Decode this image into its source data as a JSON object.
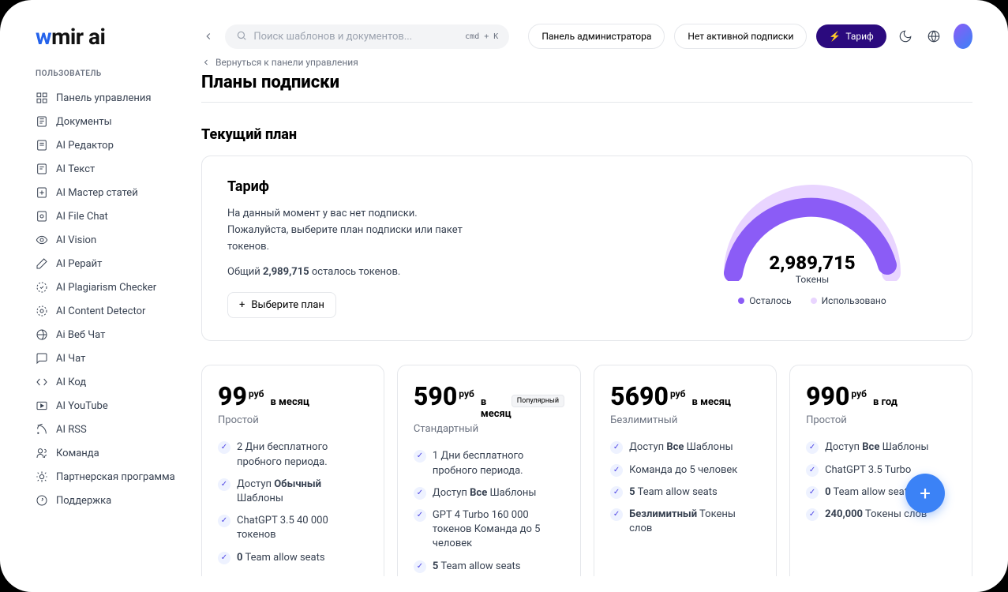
{
  "logo": {
    "part1": "w",
    "part2": "mir ",
    "part3": "ai"
  },
  "search": {
    "placeholder": "Поиск шаблонов и документов...",
    "shortcut": "cmd + K"
  },
  "topbar": {
    "admin": "Панель администратора",
    "no_sub": "Нет активной подписки",
    "tariff": "Тариф"
  },
  "sidebar": {
    "section": "ПОЛЬЗОВАТЕЛЬ",
    "items": [
      "Панель управления",
      "Документы",
      "AI Редактор",
      "AI Текст",
      "AI Мастер статей",
      "AI File Chat",
      "AI Vision",
      "AI Рерайт",
      "AI Plagiarism Checker",
      "AI Content Detector",
      "Ai Веб Чат",
      "AI Чат",
      "AI Код",
      "AI YouTube",
      "AI RSS",
      "Команда",
      "Партнерская программа",
      "Поддержка"
    ]
  },
  "breadcrumb": "Вернуться к панели управления",
  "page_title": "Планы подписки",
  "current_plan_title": "Текущий план",
  "card": {
    "title": "Тариф",
    "desc": "На данный момент у вас нет подписки. Пожалуйста, выберите план подписки или пакет токенов.",
    "total_label": "Общий",
    "total_value": "2,989,715",
    "total_suffix": "осталось токенов.",
    "choose": "Выберите план",
    "gauge_value": "2,989,715",
    "gauge_label": "Токены",
    "legend_left": "Осталось",
    "legend_right": "Использовано"
  },
  "plans": [
    {
      "price": "99",
      "currency": "руб",
      "period": "в месяц",
      "name": "Простой",
      "popular": false,
      "features": [
        "2 Дни бесплатного пробного периода.",
        "Доступ <b>Обычный</b> Шаблоны",
        "ChatGPT 3.5 40 000 токенов",
        "<b>0</b> Team allow seats"
      ]
    },
    {
      "price": "590",
      "currency": "руб",
      "period": "в месяц",
      "name": "Стандартный",
      "popular": true,
      "popular_label": "Популярный",
      "features": [
        "1 Дни бесплатного пробного периода.",
        "Доступ <b>Все</b> Шаблоны",
        "GPT 4 Turbo 160 000 токенов Команда до 5 человек",
        "<b>5</b> Team allow seats"
      ]
    },
    {
      "price": "5690",
      "currency": "руб",
      "period": "в месяц",
      "name": "Безлимитный",
      "popular": false,
      "features": [
        "Доступ <b>Все</b> Шаблоны",
        "Команда до 5 человек",
        "<b>5</b> Team allow seats",
        "<b>Безлимитный</b> Токены слов"
      ]
    },
    {
      "price": "990",
      "currency": "руб",
      "period": "в год",
      "name": "Простой",
      "popular": false,
      "features": [
        "Доступ <b>Все</b> Шаблоны",
        "ChatGPT 3.5 Turbo",
        "<b>0</b> Team allow seats",
        "<b>240,000</b> Токены слов"
      ]
    }
  ]
}
